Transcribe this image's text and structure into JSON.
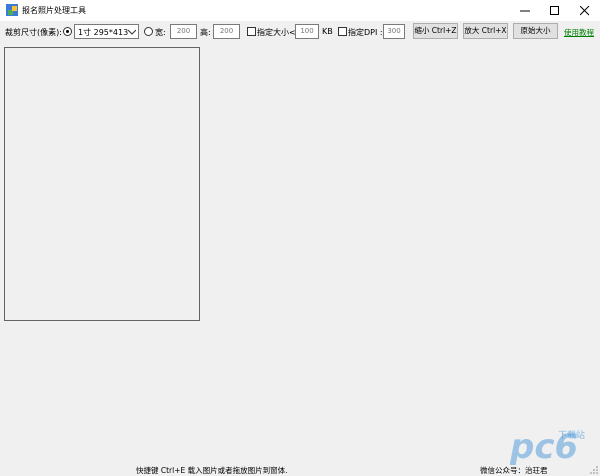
{
  "window": {
    "title": "报名照片处理工具"
  },
  "toolbar": {
    "crop_size_label": "裁剪尺寸(像素):",
    "preset_selected": "1寸  295*413",
    "width_label": "宽:",
    "width_value": "200",
    "height_label": "高:",
    "height_value": "200",
    "max_size_label": "指定大小<",
    "max_size_value": "100",
    "size_unit": "KB",
    "dpi_label": "指定DPI :",
    "dpi_value": "300",
    "shrink_button": "缩小 Ctrl+Z",
    "enlarge_button": "放大 Ctrl+X",
    "original_button": "原始大小",
    "help_link": "使用教程"
  },
  "status": {
    "hint": "快捷键 Ctrl+E 载入图片或者拖放图片到窗体.",
    "wechat": "微信公众号：治玨君"
  },
  "watermark": {
    "text": "pc6",
    "subtext": "下载站"
  },
  "colors": {
    "link": "#008000",
    "watermark": "#5aa0dc"
  }
}
